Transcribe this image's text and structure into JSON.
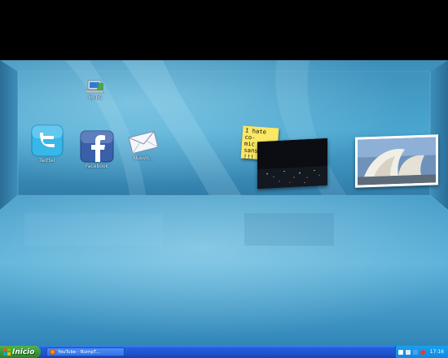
{
  "desktop": {
    "icons": [
      {
        "label": "Mi PC"
      },
      {
        "label": "Twitter"
      },
      {
        "label": "Facebook"
      },
      {
        "label": "Nuevo..."
      }
    ],
    "sticky_note": {
      "text": "I hate co-\nmic sans!-\n!!! ~~"
    }
  },
  "taskbar": {
    "start_label": "Inicio",
    "task_label": "YouTube - BumpT...",
    "clock": "17:16"
  },
  "colors": {
    "taskbar_blue": "#245edb",
    "start_green": "#379b37",
    "room_blue": "#3a9bc9",
    "sticky_yellow": "#fbe763"
  }
}
